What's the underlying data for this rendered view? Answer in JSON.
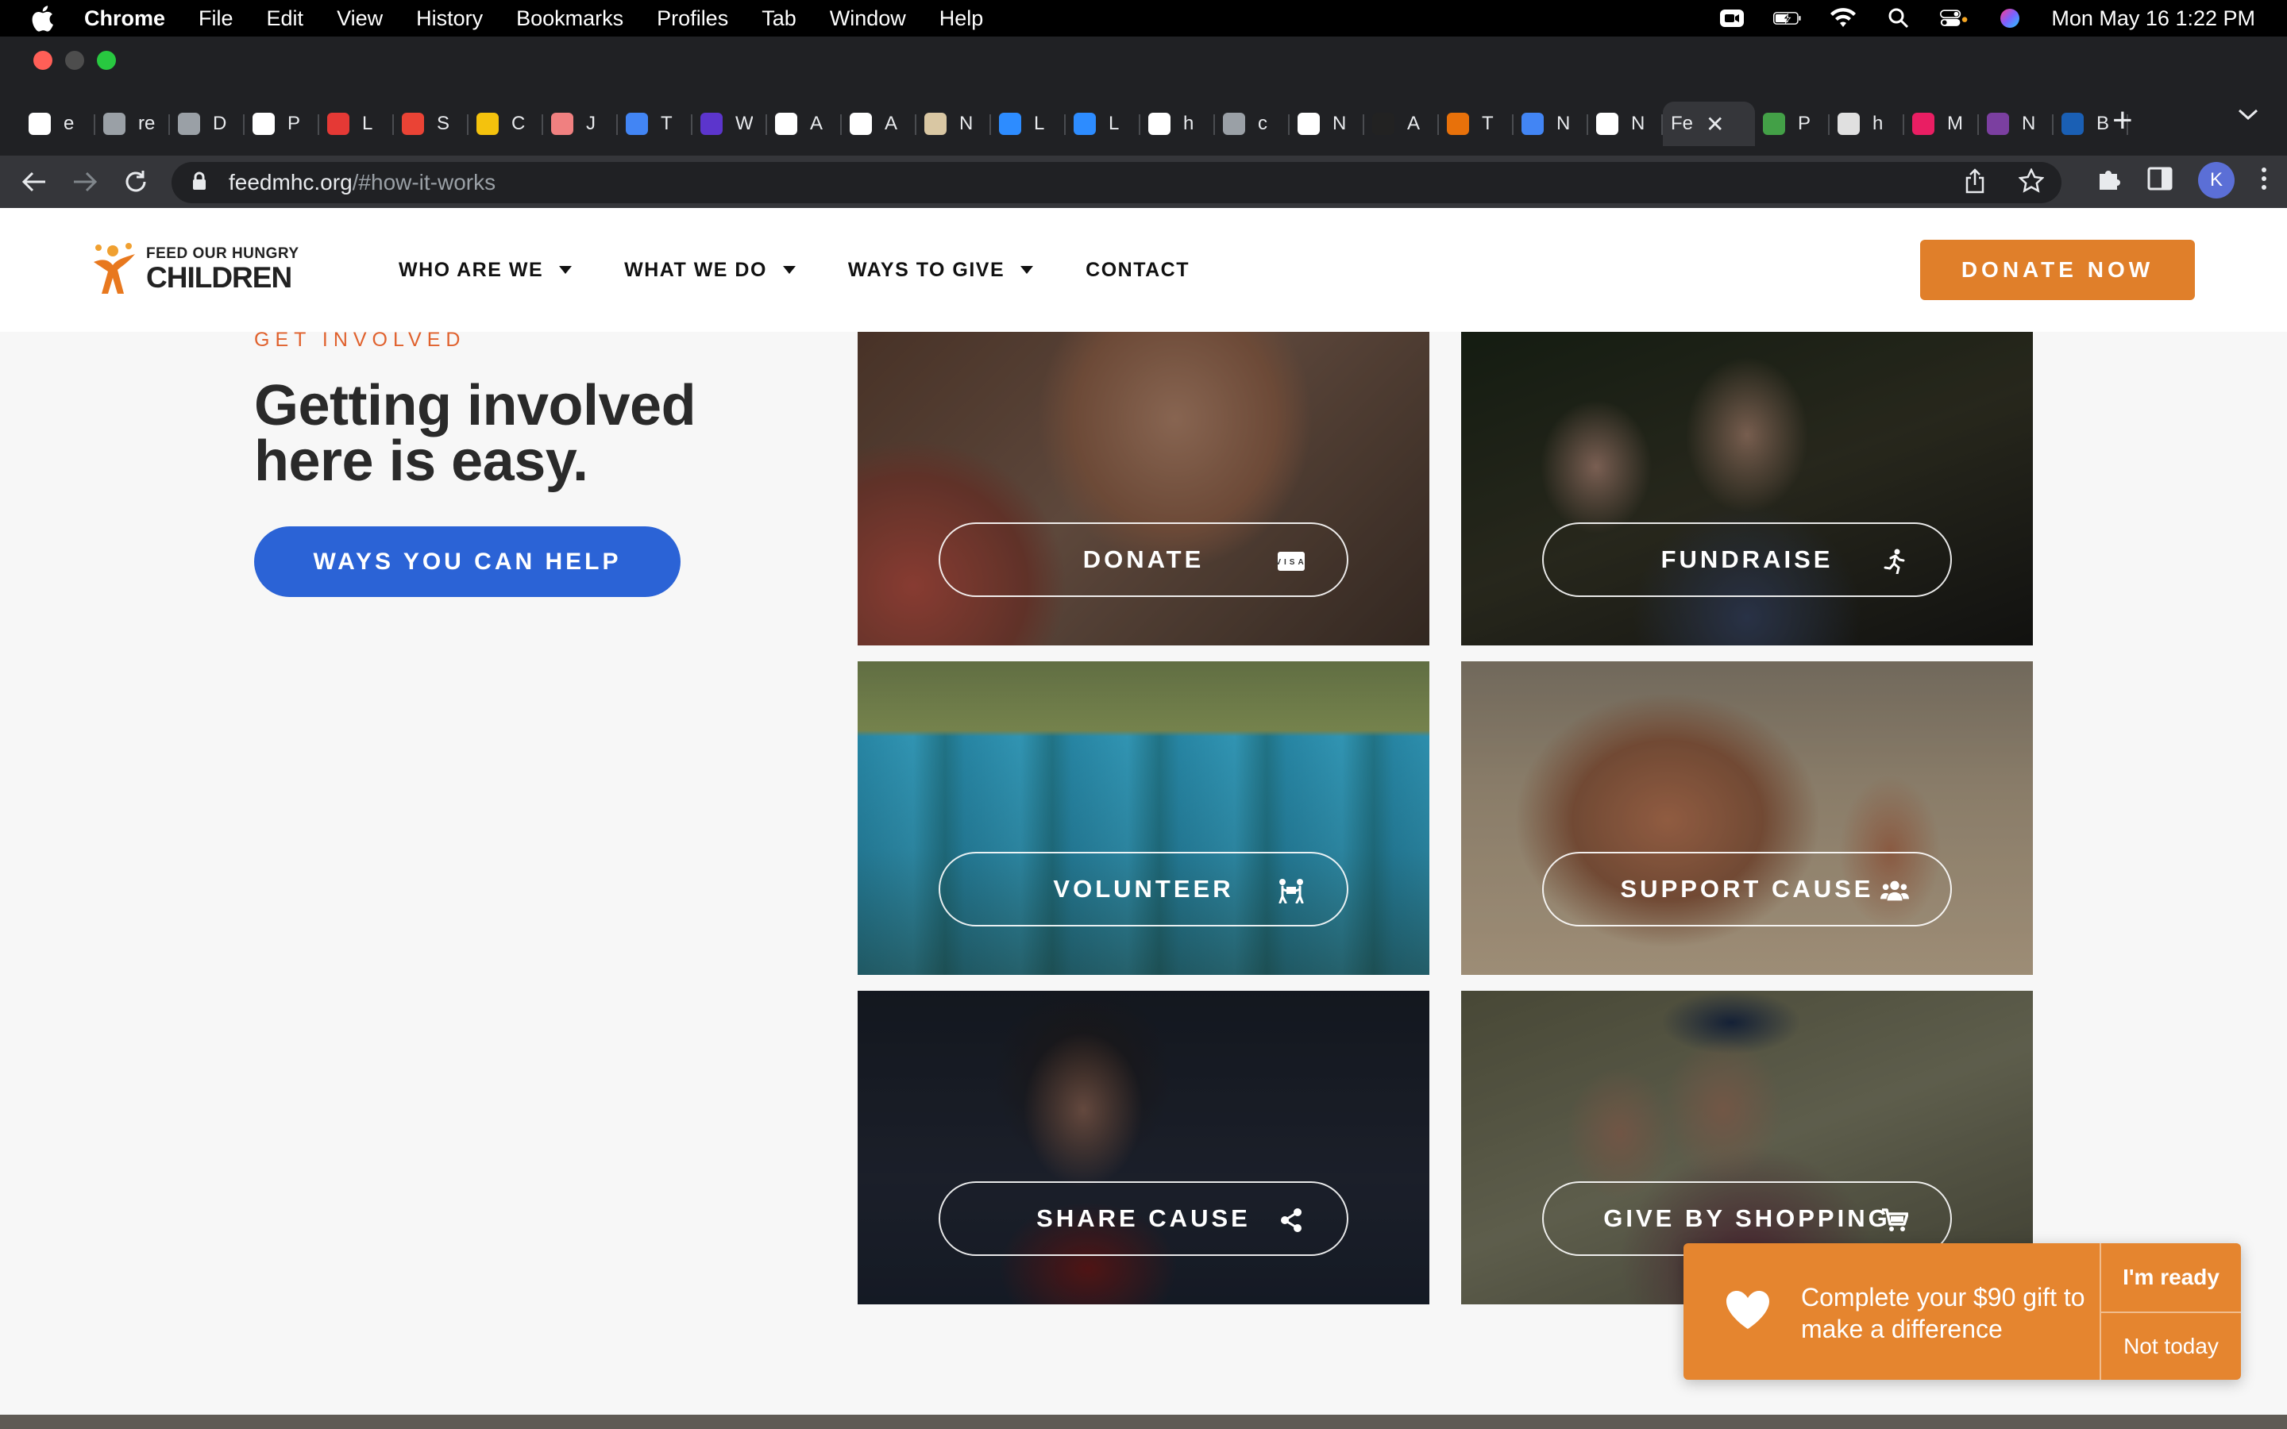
{
  "menubar": {
    "app_name": "Chrome",
    "menus": [
      "File",
      "Edit",
      "View",
      "History",
      "Bookmarks",
      "Profiles",
      "Tab",
      "Window",
      "Help"
    ],
    "clock": "Mon May 16  1:22 PM"
  },
  "browser": {
    "tabs": [
      {
        "label": "e",
        "color": "#ffffff"
      },
      {
        "label": "re",
        "color": "#9aa0a6"
      },
      {
        "label": "D",
        "color": "#9aa0a6"
      },
      {
        "label": "P",
        "color": "#ffffff"
      },
      {
        "label": "L",
        "color": "#e53935"
      },
      {
        "label": "S",
        "color": "#ea4335"
      },
      {
        "label": "C",
        "color": "#f4c20d"
      },
      {
        "label": "J",
        "color": "#f08080"
      },
      {
        "label": "T",
        "color": "#4285f4"
      },
      {
        "label": "W",
        "color": "#5c35cc"
      },
      {
        "label": "A",
        "color": "#ffffff"
      },
      {
        "label": "A",
        "color": "#ffffff"
      },
      {
        "label": "N",
        "color": "#d9c7a3"
      },
      {
        "label": "L",
        "color": "#2d8cff"
      },
      {
        "label": "L",
        "color": "#2d8cff"
      },
      {
        "label": "h",
        "color": "#ffffff"
      },
      {
        "label": "c",
        "color": "#9aa0a6"
      },
      {
        "label": "N",
        "color": "#ffffff"
      },
      {
        "label": "A",
        "color": "#222222"
      },
      {
        "label": "T",
        "color": "#e8710a"
      },
      {
        "label": "N",
        "color": "#4285f4"
      },
      {
        "label": "N",
        "color": "#ffffff"
      }
    ],
    "active_tab": {
      "label": "Fe"
    },
    "tabs_after": [
      {
        "label": "P",
        "color": "#43a047"
      },
      {
        "label": "h",
        "color": "#e0e0e0"
      },
      {
        "label": "M",
        "color": "#e91e63"
      },
      {
        "label": "N",
        "color": "#7b3fa0"
      },
      {
        "label": "B",
        "color": "#1a5fb4"
      }
    ],
    "url_domain": "feedmhc.org",
    "url_path": "/#how-it-works",
    "profile_initial": "K"
  },
  "site": {
    "logo_top": "FEED OUR HUNGRY",
    "logo_bottom": "CHILDREN",
    "nav": [
      {
        "label": "WHO ARE WE",
        "has_caret": true
      },
      {
        "label": "WHAT WE DO",
        "has_caret": true
      },
      {
        "label": "WAYS TO GIVE",
        "has_caret": true
      },
      {
        "label": "CONTACT",
        "has_caret": false
      }
    ],
    "donate_now": "DONATE NOW",
    "accent": "#e07f2a"
  },
  "content": {
    "eyebrow": "GET INVOLVED",
    "headline_line1": "Getting involved",
    "headline_line2": "here is easy.",
    "help_button": "WAYS YOU CAN HELP",
    "cards": {
      "donate": {
        "label": "DONATE",
        "icon": "visa-card-icon"
      },
      "fundraise": {
        "label": "FUNDRAISE",
        "icon": "running-person-icon"
      },
      "volunteer": {
        "label": "VOLUNTEER",
        "icon": "people-carry-icon"
      },
      "support": {
        "label": "SUPPORT CAUSE",
        "icon": "users-icon"
      },
      "share": {
        "label": "SHARE CAUSE",
        "icon": "share-icon"
      },
      "shopping": {
        "label": "GIVE BY SHOPPING",
        "icon": "cart-icon"
      }
    }
  },
  "popup": {
    "message": "Complete your $90 gift to make a difference",
    "ready": "I'm ready",
    "not_today": "Not today"
  }
}
